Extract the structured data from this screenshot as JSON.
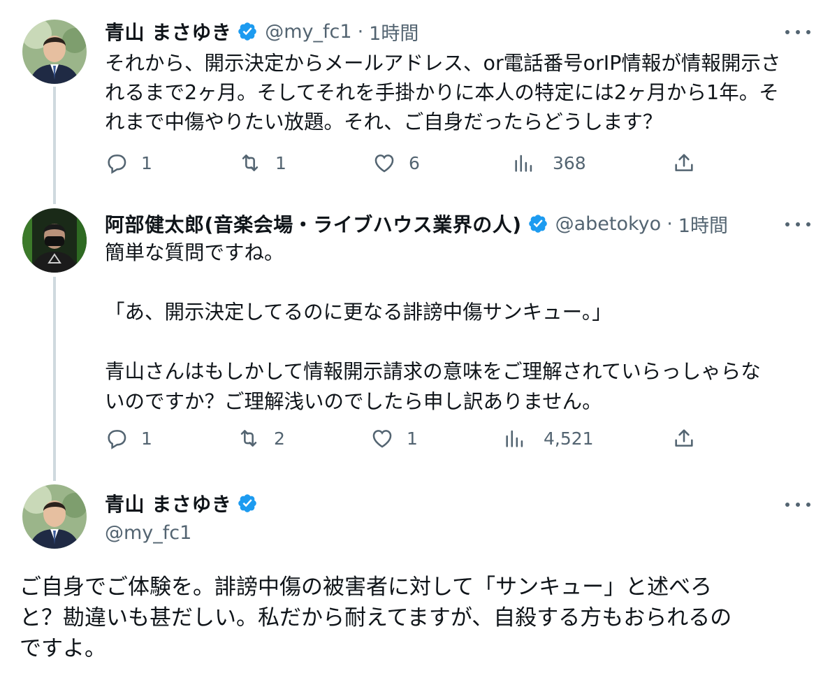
{
  "colors": {
    "text": "#0f1419",
    "secondary": "#536471",
    "verified": "#1d9bf0",
    "thread_line": "#cfd9de"
  },
  "tweets": [
    {
      "name": "青山 まさゆき",
      "handle": "@my_fc1",
      "dot": "·",
      "time": "1時間",
      "text": "それから、開示決定からメールアドレス、or電話番号orIP情報が情報開示さ\nれるまで2ヶ月。そしてそれを手掛かりに本人の特定には2ヶ月から1年。そ\nれまで中傷やりたい放題。それ、ご自身だったらどうします？",
      "replies": "1",
      "retweets": "1",
      "likes": "6",
      "views": "368"
    },
    {
      "name": "阿部健太郎(音楽会場・ライブハウス業界の人)",
      "handle": "@abetokyo",
      "dot": "·",
      "time": "1時間",
      "text": "簡単な質問ですね。\n\n「あ、開示決定してるのに更なる誹謗中傷サンキュー。」\n\n青山さんはもしかして情報開示請求の意味をご理解されていらっしゃらな\nいのですか？ご理解浅いのでしたら申し訳ありません。",
      "replies": "1",
      "retweets": "2",
      "likes": "1",
      "views": "4,521"
    }
  ],
  "main_tweet": {
    "name": "青山 まさゆき",
    "handle": "@my_fc1",
    "text": "ご自身でご体験を。誹謗中傷の被害者に対して「サンキュー」と述べろ\nと？勘違いも甚だしい。私だから耐えてますが、自殺する方もおられるの\nですよ。"
  }
}
